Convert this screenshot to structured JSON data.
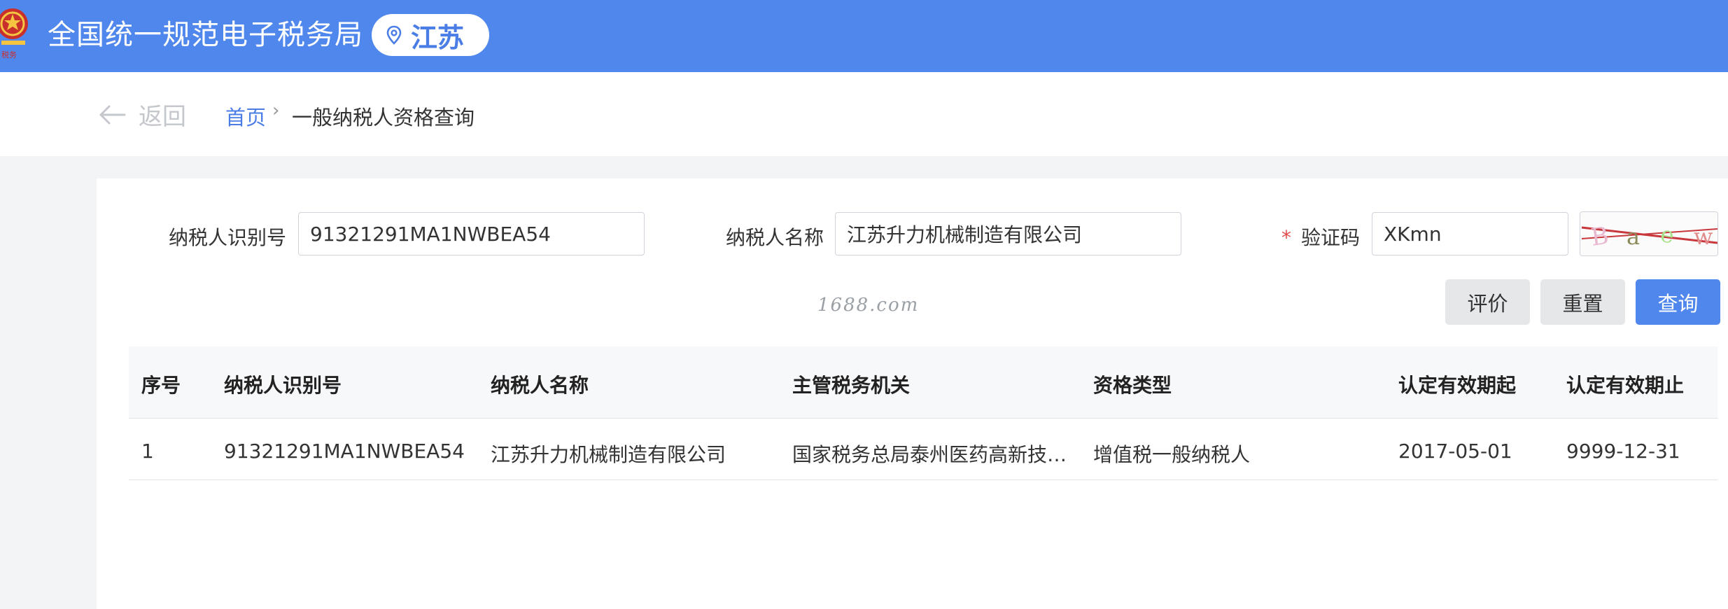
{
  "header": {
    "site_title": "全国统一规范电子税务局",
    "region": "江苏",
    "emblem_icon": "national-emblem-icon",
    "brand_color": "#5087ec"
  },
  "breadcrumb": {
    "back_label": "返回",
    "home": "首页",
    "separator": "›",
    "current": "一般纳税人资格查询"
  },
  "form": {
    "taxpayer_id_label": "纳税人识别号",
    "taxpayer_id_value": "91321291MA1NWBEA54",
    "taxpayer_name_label": "纳税人名称",
    "taxpayer_name_value": "江苏升力机械制造有限公司",
    "required_mark": "*",
    "captcha_label": "验证码",
    "captcha_value": "XKmn"
  },
  "watermark": "1688.com",
  "buttons": {
    "evaluate": "评价",
    "reset": "重置",
    "query": "查询"
  },
  "table": {
    "columns": [
      "序号",
      "纳税人识别号",
      "纳税人名称",
      "主管税务机关",
      "资格类型",
      "认定有效期起",
      "认定有效期止"
    ],
    "rows": [
      [
        "1",
        "91321291MA1NWBEA54",
        "江苏升力机械制造有限公司",
        "国家税务总局泰州医药高新技…",
        "增值税一般纳税人",
        "2017-05-01",
        "9999-12-31"
      ]
    ]
  }
}
